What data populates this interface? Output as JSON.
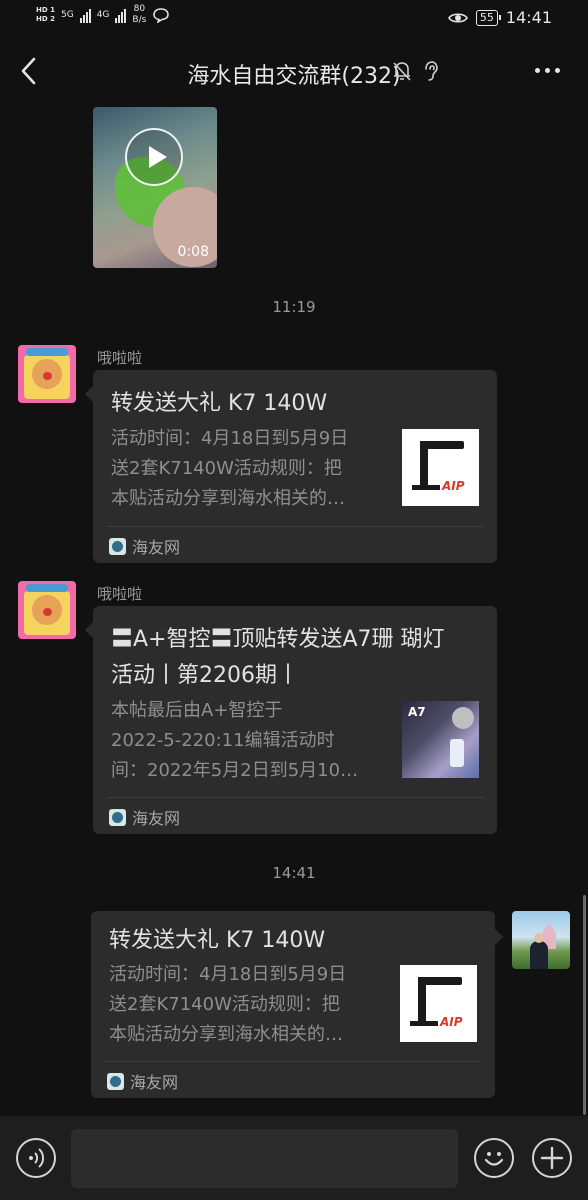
{
  "status_bar": {
    "hd1": "HD 1",
    "hd2": "HD 2",
    "net1": "5G",
    "net2": "4G",
    "speed_value": "80",
    "speed_unit": "B/s",
    "battery": "55",
    "time": "14:41"
  },
  "header": {
    "title": "海水自由交流群(232)",
    "icons": [
      "back-icon",
      "mute-bell-icon",
      "ear-icon",
      "more-icon"
    ]
  },
  "video": {
    "duration": "0:08"
  },
  "time_separators": [
    "11:19",
    "14:41"
  ],
  "messages": [
    {
      "sender": "哦啦啦",
      "title": "转发送大礼 K7 140W",
      "desc": [
        "活动时间：4月18日到5月9日",
        "送2套K7140W活动规则：把",
        "本贴活动分享到海水相关的…"
      ],
      "source": "海友网",
      "thumb_logo": "AIP"
    },
    {
      "sender": "哦啦啦",
      "title_lines": [
        "〓A+智控〓顶贴转发送A7珊 瑚灯",
        "活动丨第2206期丨"
      ],
      "desc": [
        "本帖最后由A+智控于",
        "2022-5-220:11编辑活动时",
        "间：2022年5月2日到5月10…"
      ],
      "source": "海友网",
      "thumb_label": "A7"
    },
    {
      "title": "转发送大礼 K7 140W",
      "desc": [
        "活动时间：4月18日到5月9日",
        "送2套K7140W活动规则：把",
        "本贴活动分享到海水相关的…"
      ],
      "source": "海友网",
      "thumb_logo": "AIP"
    }
  ],
  "input": {
    "placeholder": ""
  }
}
